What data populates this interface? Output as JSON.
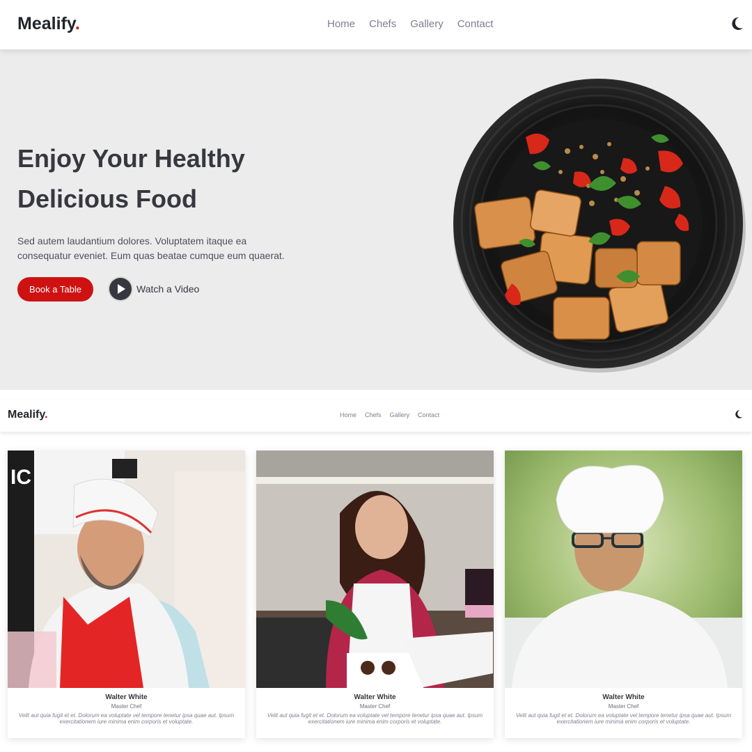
{
  "brand": {
    "name": "Mealify",
    "dot": ".",
    "accent_color": "#ce1212"
  },
  "nav": {
    "items": [
      "Home",
      "Chefs",
      "Gallery",
      "Contact"
    ],
    "theme_toggle_icon": "moon-icon"
  },
  "hero": {
    "title_line1": "Enjoy Your Healthy",
    "title_line2": "Delicious Food",
    "lead": "Sed autem laudantium dolores. Voluptatem itaque ea consequatur eveniet. Eum quas beatae cumque eum quaerat.",
    "book_button": "Book a Table",
    "video_button": "Watch a Video",
    "image_icon": "food-plate-image"
  },
  "chefs": [
    {
      "name": "Walter White",
      "role": "Master Chef",
      "description": "Velit aut quia fugit et et. Dolorum ea voluptate vel tempore tenetur ipsa quae aut. Ipsum exercitationem iure minima enim corporis et voluptate.",
      "image": "chef-photo-bearded-man"
    },
    {
      "name": "Walter White",
      "role": "Master Chef",
      "description": "Velit aut quia fugit et et. Dolorum ea voluptate vel tempore tenetur ipsa quae aut. Ipsum exercitationem iure minima enim corporis et voluptate.",
      "image": "chef-photo-woman-piping"
    },
    {
      "name": "Walter White",
      "role": "Master Chef",
      "description": "Velit aut quia fugit et et. Dolorum ea voluptate vel tempore tenetur ipsa quae aut. Ipsum exercitationem iure minima enim corporis et voluptate.",
      "image": "chef-photo-man-glasses"
    }
  ],
  "colors": {
    "hero_bg": "#ececec",
    "heading": "#37373f",
    "nav_link": "#7f7f90"
  }
}
